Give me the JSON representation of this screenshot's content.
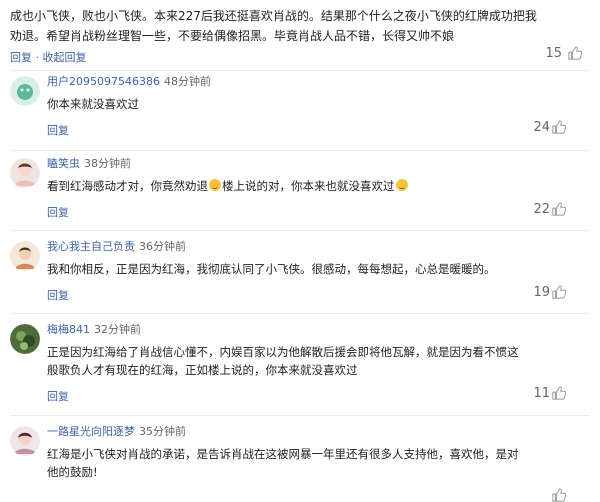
{
  "top_post": {
    "text_line1": "成也小飞侠，败也小飞侠。本来227后我还挺喜欢肖战的。结果那个什么之夜小飞侠的红牌成功把我",
    "text_line2": "劝退。希望肖战粉丝理智一些，不要给偶像招黑。毕竟肖战人品不错，长得又帅不娘",
    "reply_label": "回复",
    "collapse_label": "收起回复",
    "separator": " · ",
    "likes": "15"
  },
  "comments": [
    {
      "username": "用户2095097546386",
      "time": "48分钟前",
      "text_line1": "你本来就没喜欢过",
      "reply_label": "回复",
      "likes": "24"
    },
    {
      "username": "瞌笑虫",
      "time": "38分钟前",
      "text_part1": "看到红海感动才对，你竟然劝退",
      "text_part2": "楼上说的对，你本来也就没喜欢过",
      "emoji_name": "laughing-crying-emoji",
      "reply_label": "回复",
      "likes": "22"
    },
    {
      "username": "我心我主自己负责",
      "time": "36分钟前",
      "text_line1": "我和你相反，正是因为红海，我彻底认同了小飞侠。很感动，每每想起，心总是暖暖的。",
      "reply_label": "回复",
      "likes": "19"
    },
    {
      "username": "梅梅841",
      "time": "32分钟前",
      "text_line1": "正是因为红海给了肖战信心懂不，内娱百家以为他解散后援会即将他瓦解，就是因为看不惯这",
      "text_line2": "般歌负人才有现在的红海，正如楼上说的，你本来就没喜欢过",
      "reply_label": "回复",
      "likes": "11"
    },
    {
      "username": "一路星光向阳逐梦",
      "time": "35分钟前",
      "text_line1": "红海是小飞侠对肖战的承诺，是告诉肖战在这被网暴一年里还有很多人支持他，喜欢他，是对",
      "text_line2": "他的鼓励!"
    }
  ],
  "colors": {
    "link": "#3f63a8",
    "text": "#1f1f1f",
    "muted": "#666666",
    "divider": "#ececec"
  },
  "icons": {
    "like": "thumb-up-icon"
  }
}
